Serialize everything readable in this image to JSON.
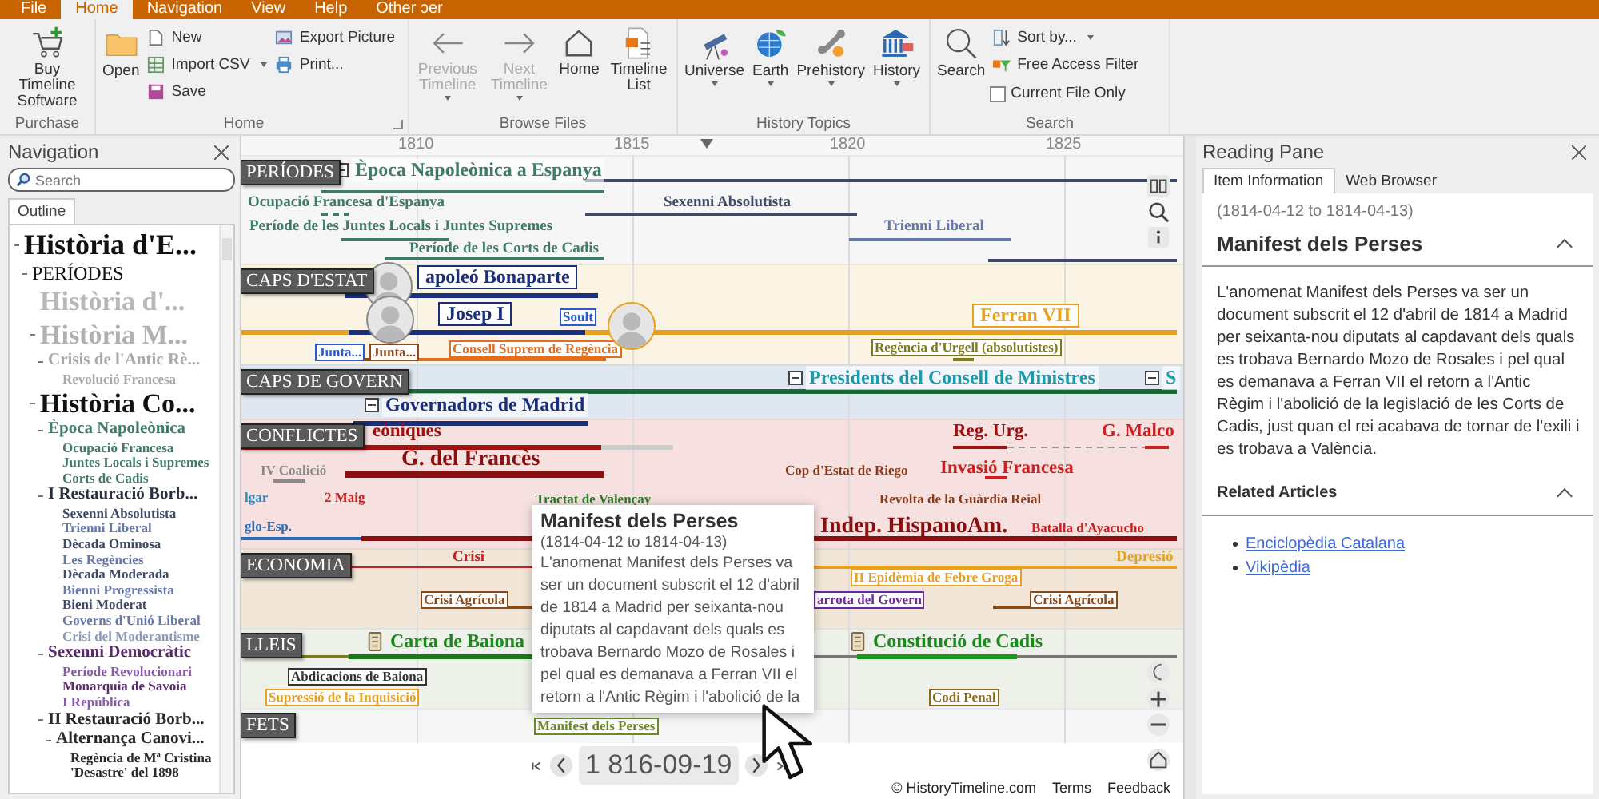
{
  "ribbon": {
    "tabs": [
      {
        "label": "File",
        "selected": false
      },
      {
        "label": "Home",
        "selected": true
      },
      {
        "label": "Navigation",
        "selected": false
      },
      {
        "label": "View",
        "selected": false
      },
      {
        "label": "Help",
        "selected": false
      },
      {
        "label": "Other ɔer",
        "selected": false
      }
    ],
    "purchase": {
      "title": "Purchase",
      "buy_button": "Buy Timeline Software"
    },
    "home_group": {
      "title": "Home",
      "open": "Open",
      "new": "New",
      "import_csv": "Import CSV",
      "save": "Save",
      "export_picture": "Export Picture",
      "print": "Print..."
    },
    "browse_files": {
      "title": "Browse Files",
      "buttons": [
        {
          "label": "Previous Timeline",
          "disabled": true,
          "dropdown": true
        },
        {
          "label": "Next Timeline",
          "disabled": true,
          "dropdown": true
        },
        {
          "label": "Home",
          "disabled": false,
          "dropdown": false
        },
        {
          "label": "Timeline List",
          "disabled": false,
          "dropdown": false
        }
      ]
    },
    "history_topics": {
      "title": "History Topics",
      "buttons": [
        {
          "label": "Universe",
          "dropdown": true
        },
        {
          "label": "Earth",
          "dropdown": true
        },
        {
          "label": "Prehistory",
          "dropdown": true
        },
        {
          "label": "History",
          "dropdown": true
        }
      ]
    },
    "search_group": {
      "title": "Search",
      "search": "Search",
      "sort_by": "Sort by...",
      "free_access_filter": "Free Access Filter",
      "current_file_only": {
        "label": "Current File Only",
        "checked": false
      }
    }
  },
  "navigation": {
    "title": "Navigation",
    "search": {
      "placeholder": "Search"
    },
    "tabs": [
      {
        "label": "Outline",
        "selected": true
      }
    ],
    "outline": [
      {
        "label": "Història d'E...",
        "kind": "root",
        "color": "#111111",
        "children": [
          {
            "label": "PERÍODES",
            "kind": "group",
            "color": "#111111",
            "children": [
              {
                "label": "Història d'...",
                "kind": "era",
                "color": "#b8b8b8"
              },
              {
                "label": "Història M...",
                "kind": "era",
                "color": "#b0b0b0",
                "children": [
                  {
                    "label": "Crisis de l'Antic Rè...",
                    "kind": "section",
                    "color": "#a8a8a8",
                    "children": [
                      {
                        "label": "Revolució Francesa",
                        "kind": "leaf",
                        "color": "#a8a8a8"
                      }
                    ]
                  }
                ]
              },
              {
                "label": "Història Co...",
                "kind": "era",
                "color": "#111111",
                "children": [
                  {
                    "label": "Època Napoleònica",
                    "kind": "section",
                    "color": "#3f7a6a",
                    "children": [
                      {
                        "label": "Ocupació Francesa",
                        "kind": "leaf",
                        "color": "#3f7a6a"
                      },
                      {
                        "label": "Juntes Locals i Supremes",
                        "kind": "leaf",
                        "color": "#3f7a6a"
                      },
                      {
                        "label": "Corts de Cadis",
                        "kind": "leaf",
                        "color": "#3f7a6a"
                      }
                    ]
                  },
                  {
                    "label": "I Restauració Borb...",
                    "kind": "section",
                    "color": "#2a3040",
                    "children": [
                      {
                        "label": "Sexenni Absolutista",
                        "kind": "leaf",
                        "color": "#3e4a66"
                      },
                      {
                        "label": "Trienni Liberal",
                        "kind": "leaf",
                        "color": "#6677aa"
                      },
                      {
                        "label": "Dècada Ominosa",
                        "kind": "leaf",
                        "color": "#3e4a66"
                      },
                      {
                        "label": "Les Regències",
                        "kind": "leaf",
                        "color": "#6677aa"
                      },
                      {
                        "label": "Dècada Moderada",
                        "kind": "leaf",
                        "color": "#3e4a66"
                      },
                      {
                        "label": "Bienni Progressista",
                        "kind": "leaf",
                        "color": "#6677aa"
                      },
                      {
                        "label": "Bieni Moderat",
                        "kind": "leaf",
                        "color": "#3e4a66"
                      },
                      {
                        "label": "Governs d'Unió Liberal",
                        "kind": "leaf",
                        "color": "#6677aa"
                      },
                      {
                        "label": "Crisi del Moderantisme",
                        "kind": "leaf",
                        "color": "#8899bb"
                      }
                    ]
                  },
                  {
                    "label": "Sexenni Democràtic",
                    "kind": "section",
                    "color": "#5a2a6a",
                    "children": [
                      {
                        "label": "Període Revolucionari",
                        "kind": "leaf",
                        "color": "#8a5aaa"
                      },
                      {
                        "label": "Monarquia de Savoia",
                        "kind": "leaf",
                        "color": "#5a2a6a"
                      },
                      {
                        "label": "I República",
                        "kind": "leaf",
                        "color": "#8a5aaa"
                      }
                    ]
                  },
                  {
                    "label": "II Restauració Borb...",
                    "kind": "section",
                    "color": "#2a2a2a",
                    "children": [
                      {
                        "label": "Alternança Canovi...",
                        "kind": "section",
                        "color": "#2a2a2a",
                        "children": [
                          {
                            "label": "Regència de Mª Cristina",
                            "kind": "leaf",
                            "color": "#2a2a2a"
                          },
                          {
                            "label": "'Desastre' del 1898",
                            "kind": "leaf",
                            "color": "#2a2a2a"
                          }
                        ]
                      }
                    ]
                  }
                ]
              }
            ]
          }
        ]
      }
    ]
  },
  "timeline": {
    "years": [
      "1810",
      "1815",
      "1820",
      "1825"
    ],
    "bands": [
      {
        "label": "PERÍODES",
        "color": "#f6f6f6"
      },
      {
        "label": "CAPS D'ESTAT",
        "color": "#fbf3e3"
      },
      {
        "label": "CAPS DE GOVERN",
        "color": "#dfe7f0"
      },
      {
        "label": "CONFLICTES",
        "color": "#f7e0e0"
      },
      {
        "label": "ECONOMIA",
        "color": "#f1e6d8"
      },
      {
        "label": "LLEIS",
        "color": "#eef0ea"
      },
      {
        "label": "FETS",
        "color": "#f6f6f6"
      }
    ],
    "items": [
      {
        "text": "Època Napoleònica a Espanya",
        "kind": "group",
        "color": "#3f7a6a"
      },
      {
        "text": "Ocupació Francesa d'Espanya",
        "kind": "period",
        "color": "#3f7a6a"
      },
      {
        "text": "Sexenni Absolutista",
        "kind": "period",
        "color": "#3e4a66"
      },
      {
        "text": "Període de les Juntes Locals i Juntes Supremes",
        "kind": "period",
        "color": "#3f7a6a"
      },
      {
        "text": "Trienni Liberal",
        "kind": "period",
        "color": "#6677aa"
      },
      {
        "text": "Període de les Corts de Cadis",
        "kind": "period",
        "color": "#3f7a6a"
      },
      {
        "text": "apoleó Bonaparte",
        "kind": "person",
        "color": "#1a2f7a"
      },
      {
        "text": "Josep I",
        "kind": "person",
        "color": "#1a2f7a"
      },
      {
        "text": "Soult",
        "kind": "boxed",
        "color": "#2a5ad0"
      },
      {
        "text": "Ferran VII",
        "kind": "person",
        "color": "#e8a020"
      },
      {
        "text": "Junta...",
        "kind": "boxed",
        "color": "#2a5ad0"
      },
      {
        "text": "Junta...",
        "kind": "boxed",
        "color": "#8a4a1a"
      },
      {
        "text": "Consell Suprem de Regència",
        "kind": "boxed",
        "color": "#e07020"
      },
      {
        "text": "Regència d'Urgell (absolutistes)",
        "kind": "boxed",
        "color": "#7a7a20"
      },
      {
        "text": "Presidents del Consell de Ministres",
        "kind": "group",
        "color": "#1a9aaa"
      },
      {
        "text": "S",
        "kind": "group",
        "color": "#1a9aaa"
      },
      {
        "text": "Governadors de Madrid",
        "kind": "group",
        "color": "#1a2f7a"
      },
      {
        "text": "eòniques",
        "kind": "conflict",
        "color": "#a01010"
      },
      {
        "text": "Reg. Urg.",
        "kind": "conflict",
        "color": "#a01010"
      },
      {
        "text": "G. Malco",
        "kind": "conflict",
        "color": "#cc2020"
      },
      {
        "text": "G. del Francès",
        "kind": "major",
        "color": "#8a1010"
      },
      {
        "text": "IV Coalició",
        "kind": "event",
        "color": "#888888"
      },
      {
        "text": "Cop d'Estat de Riego",
        "kind": "event",
        "color": "#8a3a1a"
      },
      {
        "text": "Invasió Francesa",
        "kind": "conflict",
        "color": "#cc2020"
      },
      {
        "text": "lgar",
        "kind": "event",
        "color": "#2a8ac0"
      },
      {
        "text": "2 Maig",
        "kind": "event",
        "color": "#cc2020"
      },
      {
        "text": "Tractat de Valençay",
        "kind": "event",
        "color": "#2a7a2a"
      },
      {
        "text": "Revolta de la Guàrdia Reial",
        "kind": "event",
        "color": "#8a3a1a"
      },
      {
        "text": "glo-Esp.",
        "kind": "event",
        "color": "#2a6ab0"
      },
      {
        "text": "Indep. HispanoAm.",
        "kind": "major",
        "color": "#8a1010"
      },
      {
        "text": "Batalla d'Ayacucho",
        "kind": "event",
        "color": "#cc2020"
      },
      {
        "text": "Crisi",
        "kind": "period",
        "color": "#cc2020"
      },
      {
        "text": "Depresió",
        "kind": "period",
        "color": "#e8a020"
      },
      {
        "text": "II Epidèmia de Febre Groga",
        "kind": "boxed",
        "color": "#e8a020"
      },
      {
        "text": "Crisi Agrícola",
        "kind": "boxed",
        "color": "#8a4a1a"
      },
      {
        "text": "arrota del Govern",
        "kind": "boxed",
        "color": "#6a2a9a"
      },
      {
        "text": "Crisi Agrícola",
        "kind": "boxed",
        "color": "#8a4a1a"
      },
      {
        "text": "Carta de Baiona",
        "kind": "law",
        "color": "#1a8a1a"
      },
      {
        "text": "Constitució de Cadis",
        "kind": "law",
        "color": "#1a8a1a"
      },
      {
        "text": "Abdicacions de Baiona",
        "kind": "boxed",
        "color": "#333333"
      },
      {
        "text": "Supressió de la Inquisició",
        "kind": "boxed",
        "color": "#e8a020"
      },
      {
        "text": "Codi Penal",
        "kind": "boxed",
        "color": "#8a6a1a"
      },
      {
        "text": "Manifest dels Perses",
        "kind": "boxed",
        "color": "#6a8a2a"
      }
    ],
    "tooltip": {
      "title": "Manifest dels Perses",
      "dates": "(1814-04-12 to 1814-04-13)",
      "text": "L'anomenat Manifest dels Perses va ser un document subscrit el 12 d'abril de 1814 a Madrid per seixanta-nou diputats al capdavant dels quals es trobava Bernardo Mozo de Rosales i pel qual es demanava a Ferran VII el retorn a l'Antic Règim i l'abolició de la"
    },
    "date_display": "1 816-09-19",
    "footer": {
      "copyright": "© HistoryTimeline.com",
      "links": [
        "Terms",
        "Feedback"
      ]
    }
  },
  "reading_pane": {
    "title": "Reading Pane",
    "tabs": [
      {
        "label": "Item Information",
        "selected": true
      },
      {
        "label": "Web Browser",
        "selected": false
      }
    ],
    "dates": "(1814-04-12 to 1814-04-13)",
    "heading": "Manifest dels Perses",
    "text": "L'anomenat Manifest dels Perses va ser un document subscrit el 12 d'abril de 1814 a Madrid per seixanta-nou diputats al capdavant dels quals es trobava Bernardo Mozo de Rosales i pel qual es demanava a Ferran VII el retorn a l'Antic Règim i l'abolició de la legislació de les Corts de Cadis, just quan el rei acabava de tornar de l'exili i es trobava a València.",
    "related_title": "Related Articles",
    "related_articles": [
      "Enciclopèdia Catalana",
      "Vikipèdia"
    ]
  }
}
